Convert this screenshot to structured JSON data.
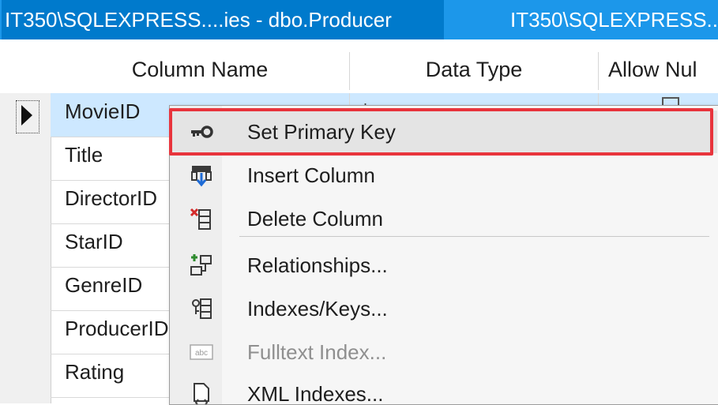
{
  "tabs": [
    {
      "label": "IT350\\SQLEXPRESS....ies - dbo.Producer"
    },
    {
      "label": "IT350\\SQLEXPRESS..."
    }
  ],
  "table": {
    "columns": [
      "Column Name",
      "Data Type",
      "Allow Nul"
    ],
    "rows": [
      {
        "name": "MovieID"
      },
      {
        "name": "Title"
      },
      {
        "name": "DirectorID"
      },
      {
        "name": "StarID"
      },
      {
        "name": "GenreID"
      },
      {
        "name": "ProducerID"
      },
      {
        "name": "Rating"
      }
    ]
  },
  "context_menu": {
    "items": [
      {
        "label": "Set Primary Key",
        "icon": "key-icon"
      },
      {
        "label": "Insert Column",
        "icon": "insert-column-icon"
      },
      {
        "label": "Delete Column",
        "icon": "delete-column-icon"
      },
      {
        "label": "Relationships...",
        "icon": "relationships-icon"
      },
      {
        "label": "Indexes/Keys...",
        "icon": "indexes-keys-icon"
      },
      {
        "label": "Fulltext Index...",
        "icon": "fulltext-index-icon",
        "disabled": true
      },
      {
        "label": "XML Indexes...",
        "icon": "xml-indexes-icon"
      }
    ]
  },
  "colors": {
    "tab_bar": "#1c97ea",
    "active_tab": "#007acc",
    "selected_row": "#cde8ff",
    "highlight_callout": "#e8343c"
  }
}
